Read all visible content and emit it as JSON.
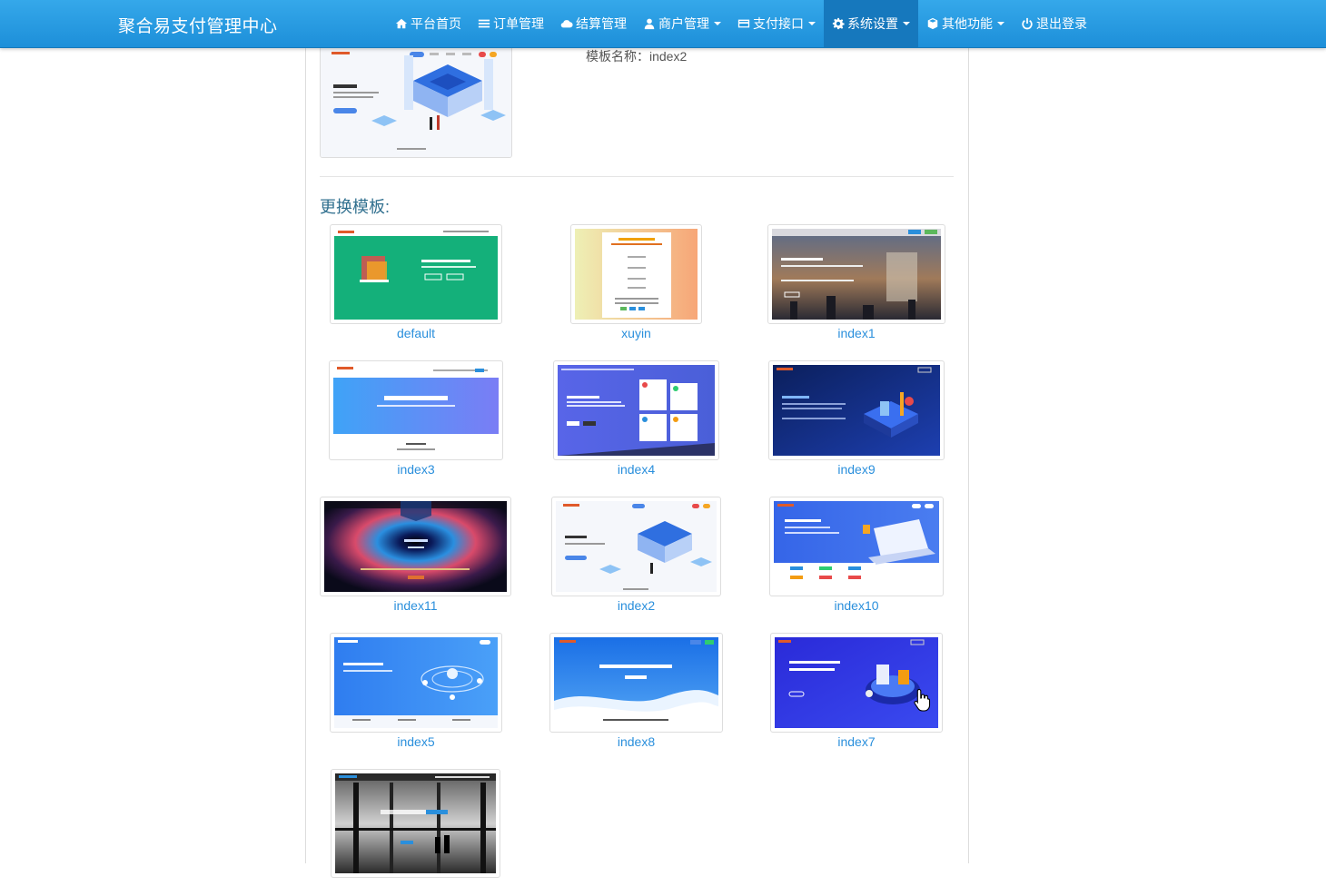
{
  "app": {
    "brand": "聚合易支付管理中心"
  },
  "nav": {
    "items": [
      {
        "label": "平台首页",
        "icon": "home-icon",
        "dropdown": false
      },
      {
        "label": "订单管理",
        "icon": "list-icon",
        "dropdown": false
      },
      {
        "label": "结算管理",
        "icon": "cloud-icon",
        "dropdown": false
      },
      {
        "label": "商户管理",
        "icon": "user-icon",
        "dropdown": true
      },
      {
        "label": "支付接口",
        "icon": "credit-card-icon",
        "dropdown": true
      },
      {
        "label": "系统设置",
        "icon": "gear-icon",
        "dropdown": true,
        "active": true
      },
      {
        "label": "其他功能",
        "icon": "cube-icon",
        "dropdown": true
      },
      {
        "label": "退出登录",
        "icon": "power-icon",
        "dropdown": false
      }
    ]
  },
  "current": {
    "name_text": "模板名称：index2"
  },
  "section": {
    "title": "更换模板:"
  },
  "templates": [
    {
      "name": "default",
      "theme": "green"
    },
    {
      "name": "xuyin",
      "theme": "peach"
    },
    {
      "name": "index1",
      "theme": "dark-city"
    },
    {
      "name": "index3",
      "theme": "blue-banner"
    },
    {
      "name": "index4",
      "theme": "purple-cards"
    },
    {
      "name": "index9",
      "theme": "navy-iso"
    },
    {
      "name": "index11",
      "theme": "galaxy"
    },
    {
      "name": "index2",
      "theme": "iso-white"
    },
    {
      "name": "index10",
      "theme": "blue-laptop"
    },
    {
      "name": "index5",
      "theme": "blue-orbit"
    },
    {
      "name": "index8",
      "theme": "blue-wave"
    },
    {
      "name": "index7",
      "theme": "indigo-iso"
    },
    {
      "name": "",
      "theme": "bw-city"
    }
  ],
  "colors": {
    "navbar": "#2a9de6",
    "nav_active": "#1678bd",
    "link": "#2a8fdc",
    "section_title": "#31708f"
  }
}
